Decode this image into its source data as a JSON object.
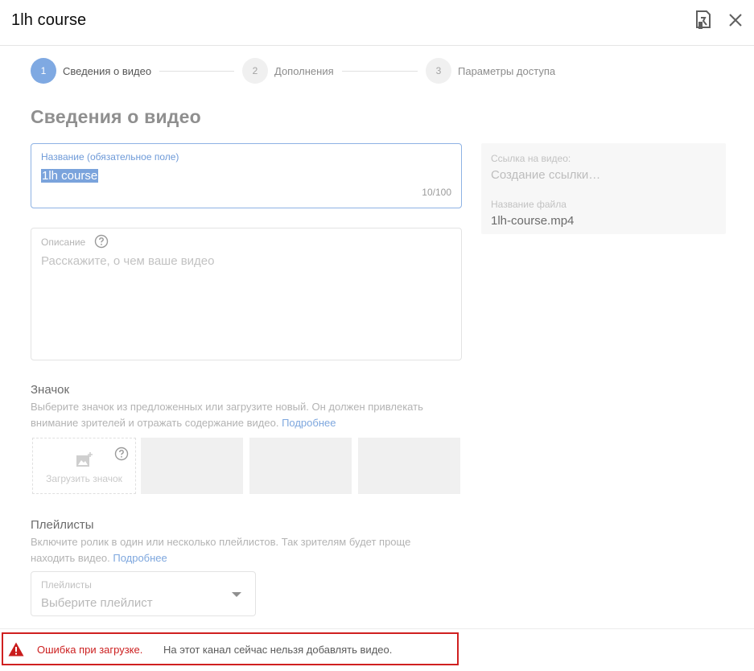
{
  "dialog": {
    "title": "1lh course",
    "icons": {
      "feedback": "feedback-icon",
      "close": "close-icon"
    }
  },
  "stepper": {
    "steps": [
      {
        "number": "1",
        "label": "Сведения о видео",
        "active": true
      },
      {
        "number": "2",
        "label": "Дополнения",
        "active": false
      },
      {
        "number": "3",
        "label": "Параметры доступа",
        "active": false
      }
    ]
  },
  "details": {
    "heading": "Сведения о видео",
    "title_field": {
      "label": "Название (обязательное поле)",
      "value": "1lh course",
      "counter": "10/100"
    },
    "description_field": {
      "label": "Описание",
      "placeholder": "Расскажите, о чем ваше видео"
    }
  },
  "info_card": {
    "link_label": "Ссылка на видео:",
    "link_value": "Создание ссылки…",
    "filename_label": "Название файла",
    "filename_value": "1lh-course.mp4"
  },
  "thumbnail": {
    "heading": "Значок",
    "description": "Выберите значок из предложенных или загрузите новый. Он должен привлекать внимание зрителей и отражать содержание видео.",
    "learn_more": "Подробнее",
    "upload_label": "Загрузить значок"
  },
  "playlists": {
    "heading": "Плейлисты",
    "description": "Включите ролик в один или несколько плейлистов. Так зрителям будет проще находить видео.",
    "learn_more": "Подробнее",
    "select_label": "Плейлисты",
    "select_value": "Выберите плейлист"
  },
  "error": {
    "title": "Ошибка при загрузке.",
    "message": "На этот канал сейчас нельзя добавлять видео.",
    "color": "#cc1f1f"
  },
  "colors": {
    "accent": "#7fa9e2",
    "link": "#7ea7de",
    "error_border": "#d02020"
  }
}
